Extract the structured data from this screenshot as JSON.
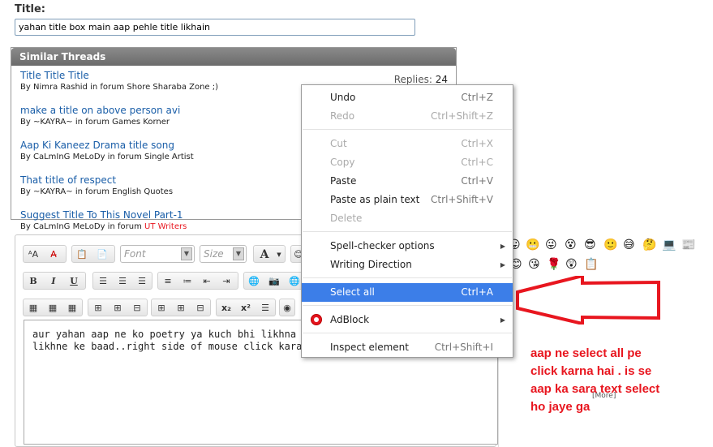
{
  "title_field": {
    "label": "Title:",
    "value": "yahan title box main aap pehle title likhain"
  },
  "similar_threads": {
    "heading": "Similar Threads",
    "items": [
      {
        "title": "Title Title Title",
        "by": "By Nimra Rashid in forum Shore Sharaba Zone ;)",
        "replies_label": "Replies:",
        "replies": "24",
        "forum_colored": ""
      },
      {
        "title": "make a title on above person avi",
        "by": "By ~KAYRA~ in forum Games Korner",
        "forum_colored": ""
      },
      {
        "title": "Aap Ki Kaneez Drama title song",
        "by": "By CaLmInG MeLoDy in forum Single Artist",
        "forum_colored": ""
      },
      {
        "title": "That title of respect",
        "by": "By ~KAYRA~ in forum English Quotes",
        "forum_colored": ""
      },
      {
        "title": "Suggest Title To This Novel Part-1",
        "by": "By CaLmInG MeLoDy in forum",
        "forum_colored": "UT Writers"
      }
    ]
  },
  "editor": {
    "font_placeholder": "Font",
    "size_placeholder": "Size",
    "text_line1": "aur yahan aap ne ko poetry ya kuch bhi likhna ha",
    "text_line2": "likhne ke baad..right side of mouse click karain"
  },
  "context_menu": {
    "items": [
      {
        "label": "Undo",
        "shortcut": "Ctrl+Z"
      },
      {
        "label": "Redo",
        "shortcut": "Ctrl+Shift+Z"
      },
      {
        "label": "Cut",
        "shortcut": "Ctrl+X"
      },
      {
        "label": "Copy",
        "shortcut": "Ctrl+C"
      },
      {
        "label": "Paste",
        "shortcut": "Ctrl+V"
      },
      {
        "label": "Paste as plain text",
        "shortcut": "Ctrl+Shift+V"
      },
      {
        "label": "Delete",
        "shortcut": ""
      },
      {
        "label": "Spell-checker options",
        "shortcut": ""
      },
      {
        "label": "Writing Direction",
        "shortcut": ""
      },
      {
        "label": "Select all",
        "shortcut": "Ctrl+A"
      },
      {
        "label": "AdBlock",
        "shortcut": ""
      },
      {
        "label": "Inspect element",
        "shortcut": "Ctrl+Shift+I"
      }
    ]
  },
  "smilies_more": "[More]",
  "annotation": {
    "line1": "aap ne select all pe",
    "line2": "click karna hai . is se",
    "line3": "aap ka sara text select",
    "line4": "ho jaye ga"
  },
  "colors": {
    "link": "#1a5ea8",
    "highlight": "#3c7ee8",
    "annotation": "#e8161f"
  }
}
